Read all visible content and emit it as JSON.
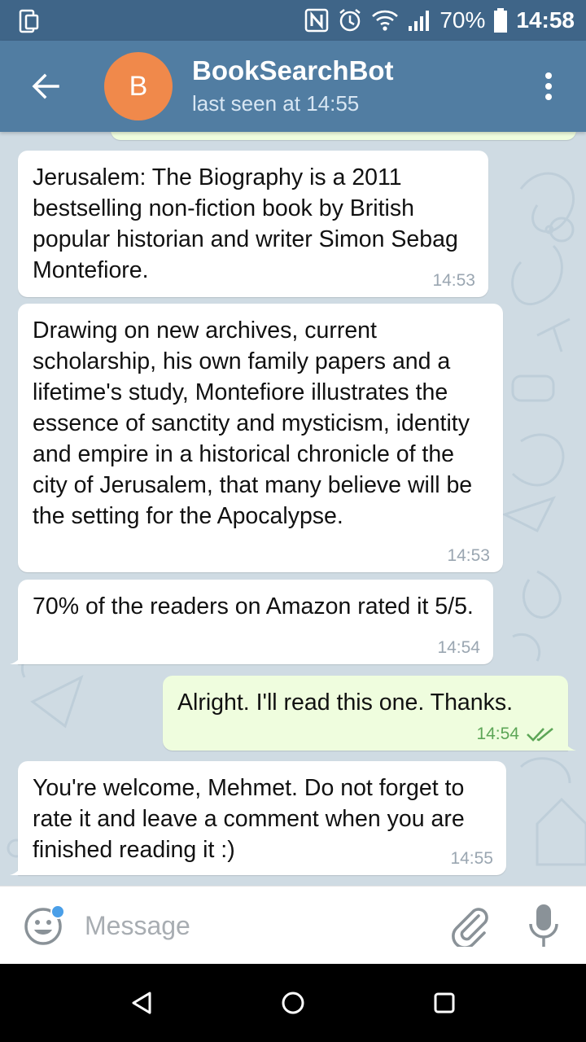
{
  "status_bar": {
    "battery": "70%",
    "time": "14:58",
    "icons": [
      "device-icon",
      "nfc-icon",
      "alarm-icon",
      "wifi-icon",
      "signal-icon",
      "battery-icon"
    ]
  },
  "header": {
    "avatar_letter": "B",
    "avatar_color": "#f0894b",
    "title": "BookSearchBot",
    "status": "last seen at 14:55",
    "accent": "#517da2"
  },
  "messages": [
    {
      "direction": "in",
      "text": "Jerusalem: The Biography is a 2011 bestselling non-fiction book by British popular historian and writer Simon Sebag Montefiore.",
      "time": "14:53"
    },
    {
      "direction": "in",
      "text": "Drawing on new archives, current scholarship, his own family papers and a lifetime's study, Montefiore illustrates the essence of sanctity and mysticism, identity and empire in a historical chronicle of the city of Jerusalem, that many believe will be the setting for the Apocalypse.",
      "time": "14:53"
    },
    {
      "direction": "in",
      "text": "70% of the readers on Amazon rated it 5/5.",
      "time": "14:54"
    },
    {
      "direction": "out",
      "text": "Alright. I'll read this one. Thanks.",
      "time": "14:54",
      "read": true
    },
    {
      "direction": "in",
      "text": "You're welcome, Mehmet. Do not forget to rate it and leave a comment when you are finished reading it :)",
      "time": "14:55"
    }
  ],
  "input": {
    "placeholder": "Message",
    "value": ""
  },
  "colors": {
    "chat_bg": "#cfdbe3",
    "incoming_bubble": "#ffffff",
    "outgoing_bubble": "#effdde",
    "read_check": "#5da657"
  }
}
